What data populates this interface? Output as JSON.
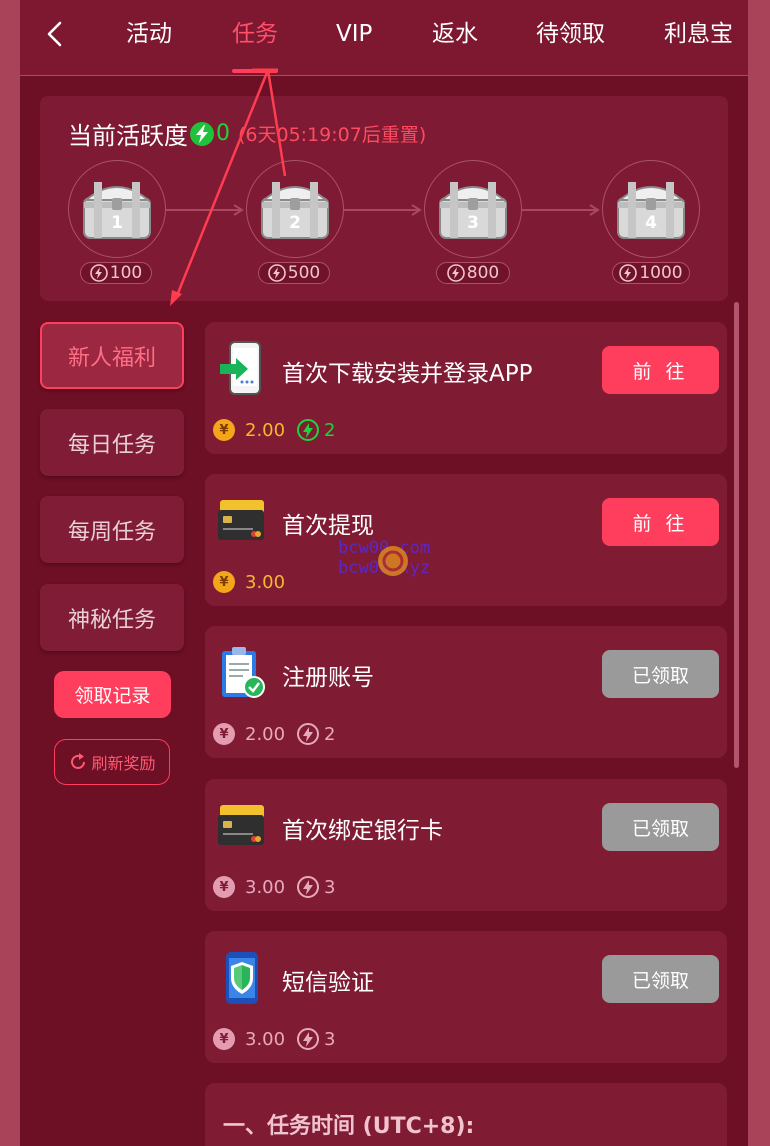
{
  "tabs": [
    {
      "label": "活动",
      "active": false
    },
    {
      "label": "任务",
      "active": true
    },
    {
      "label": "VIP",
      "active": false
    },
    {
      "label": "返水",
      "active": false
    },
    {
      "label": "待领取",
      "active": false
    },
    {
      "label": "利息宝",
      "active": false
    }
  ],
  "activity": {
    "title": "当前活跃度",
    "value": "0",
    "reset_text": "(6天05:19:07后重置)",
    "chests": [
      {
        "num": "1",
        "points": "100"
      },
      {
        "num": "2",
        "points": "500"
      },
      {
        "num": "3",
        "points": "800"
      },
      {
        "num": "4",
        "points": "1000"
      }
    ]
  },
  "sidebar": {
    "items": [
      {
        "label": "新人福利",
        "active": true
      },
      {
        "label": "每日任务",
        "active": false
      },
      {
        "label": "每周任务",
        "active": false
      },
      {
        "label": "神秘任务",
        "active": false
      }
    ],
    "records_label": "领取记录",
    "refresh_label": "刷新奖励"
  },
  "tasks": [
    {
      "title": "首次下载安装并登录APP",
      "icon": "phone-download-icon",
      "button": "前 往",
      "state": "go",
      "coin": "2.00",
      "points": "2"
    },
    {
      "title": "首次提现",
      "icon": "bank-card-icon",
      "button": "前 往",
      "state": "go",
      "coin": "3.00",
      "points": ""
    },
    {
      "title": "注册账号",
      "icon": "clipboard-check-icon",
      "button": "已领取",
      "state": "done",
      "coin": "2.00",
      "points": "2"
    },
    {
      "title": "首次绑定银行卡",
      "icon": "bank-card-icon",
      "button": "已领取",
      "state": "done",
      "coin": "3.00",
      "points": "3"
    },
    {
      "title": "短信验证",
      "icon": "shield-phone-icon",
      "button": "已领取",
      "state": "done",
      "coin": "3.00",
      "points": "3"
    }
  ],
  "rules": {
    "title": "一、任务时间 (UTC+8):"
  },
  "watermark": {
    "line1": "bcw00.com",
    "line2": "bcw00.xyz"
  },
  "colors": {
    "accent": "#ff3d5c",
    "page_bg": "#6d0f25",
    "panel_bg": "#801b34",
    "green": "#1fd33b",
    "coin_gold": "#f5a51a"
  }
}
